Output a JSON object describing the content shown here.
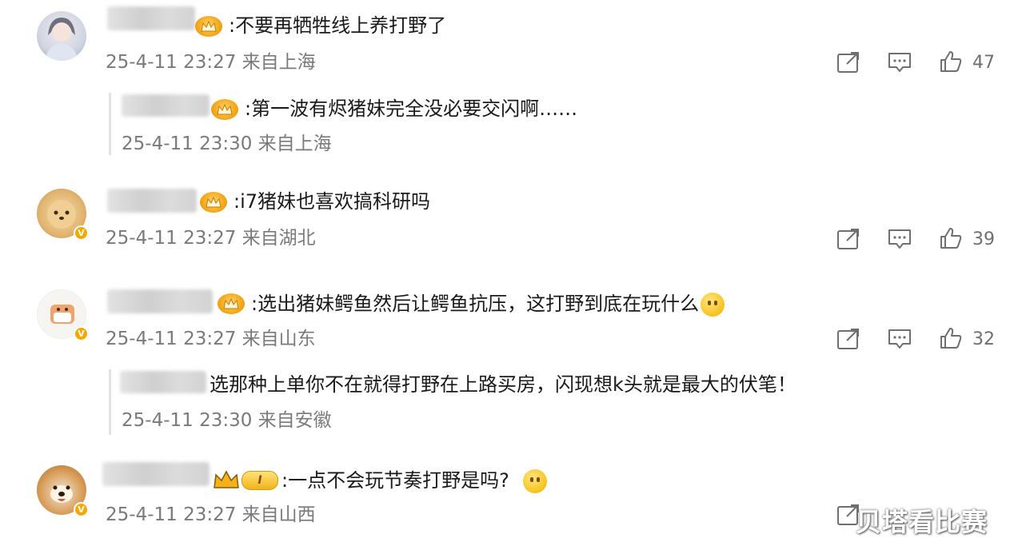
{
  "comments": [
    {
      "id": "c1",
      "text": ":不要再牺牲线上养打野了",
      "time": "25-4-11 23:27",
      "location": "来自上海",
      "likes": "47",
      "avatar_icon": "anime-girl-avatar",
      "reply": {
        "text": ":第一波有烬猪妹完全没必要交闪啊……",
        "time": "25-4-11 23:30",
        "location": "来自上海"
      }
    },
    {
      "id": "c2",
      "text": ":i7猪妹也喜欢搞科研吗",
      "time": "25-4-11 23:27",
      "location": "来自湖北",
      "likes": "39",
      "avatar_icon": "pomeranian-dog-avatar"
    },
    {
      "id": "c3",
      "text": ":选出猪妹鳄鱼然后让鳄鱼抗压，这打野到底在玩什么",
      "time": "25-4-11 23:27",
      "location": "来自山东",
      "likes": "32",
      "avatar_icon": "cartoon-cat-avatar",
      "reply": {
        "text": "选那种上单你不在就得打野在上路买房，闪现想k头就是最大的伏笔！",
        "time": "25-4-11 23:30",
        "location": "来自安徽"
      }
    },
    {
      "id": "c4",
      "text": ":一点不会玩节奏打野是吗?",
      "time": "25-4-11 23:27",
      "location": "来自山西",
      "avatar_icon": "shiba-dog-avatar",
      "vip_level": "I"
    }
  ],
  "watermark": "贝塔看比赛",
  "colors": {
    "accent_badge": "#f6a800",
    "meta_text": "#7a7a7a",
    "icon_gray": "#6f6f6f"
  },
  "icons": {
    "share": "share-icon",
    "comment": "comment-icon",
    "like": "like-icon",
    "crown": "crown-badge-icon",
    "emoji": "smile-emoji-icon"
  }
}
